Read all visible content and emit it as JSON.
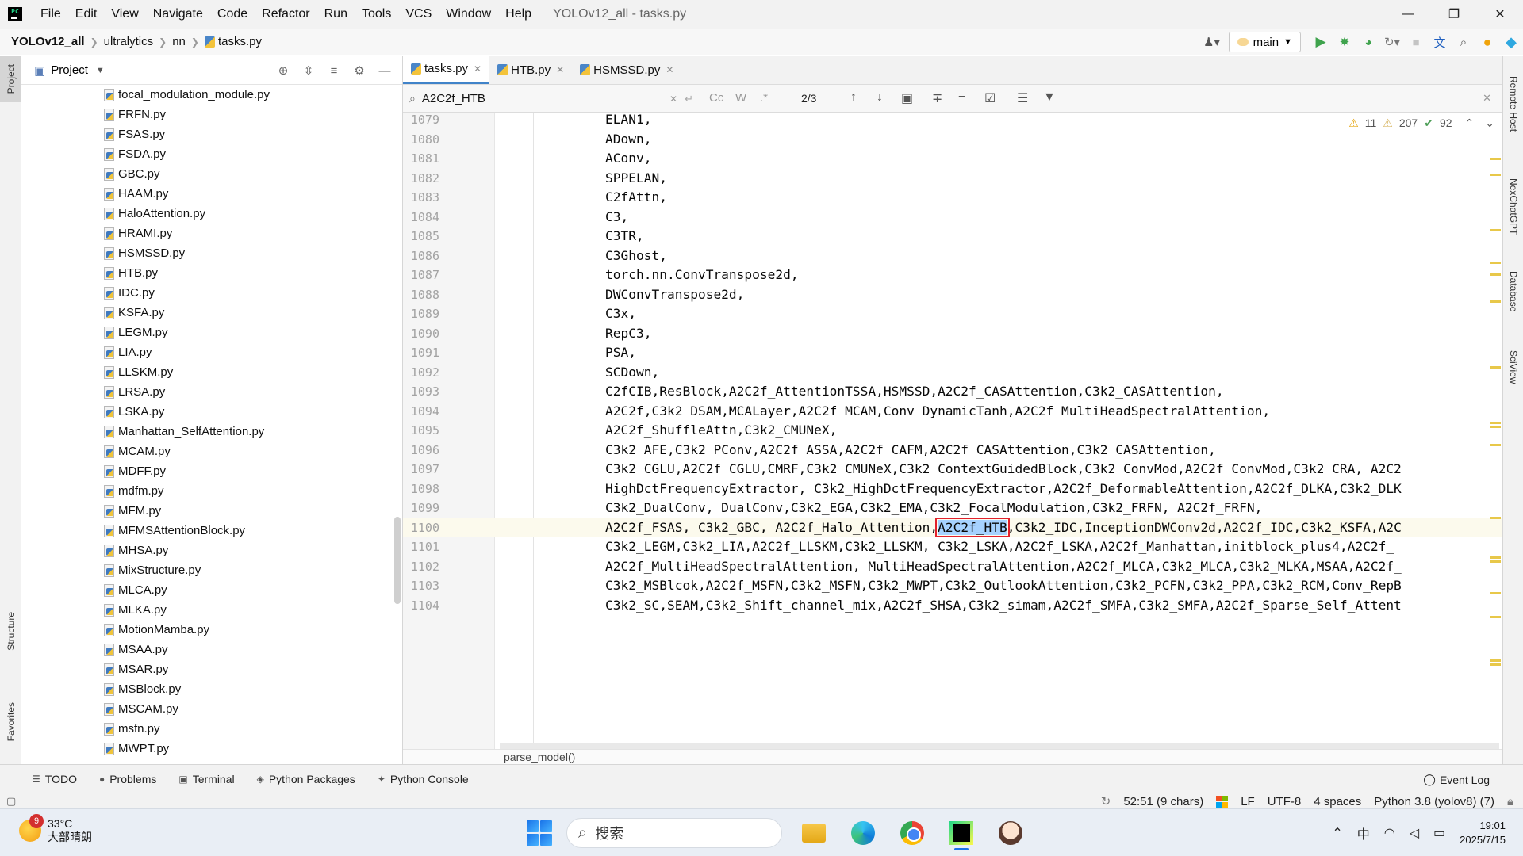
{
  "window": {
    "title": "YOLOv12_all - tasks.py",
    "menu": [
      "File",
      "Edit",
      "View",
      "Navigate",
      "Code",
      "Refactor",
      "Run",
      "Tools",
      "VCS",
      "Window",
      "Help"
    ]
  },
  "breadcrumb": [
    "YOLOv12_all",
    "ultralytics",
    "nn",
    "tasks.py"
  ],
  "navbar": {
    "branch": "main"
  },
  "project": {
    "title": "Project",
    "files": [
      "focal_modulation_module.py",
      "FRFN.py",
      "FSAS.py",
      "FSDA.py",
      "GBC.py",
      "HAAM.py",
      "HaloAttention.py",
      "HRAMI.py",
      "HSMSSD.py",
      "HTB.py",
      "IDC.py",
      "KSFA.py",
      "LEGM.py",
      "LIA.py",
      "LLSKM.py",
      "LRSA.py",
      "LSKA.py",
      "Manhattan_SelfAttention.py",
      "MCAM.py",
      "MDFF.py",
      "mdfm.py",
      "MFM.py",
      "MFMSAttentionBlock.py",
      "MHSA.py",
      "MixStructure.py",
      "MLCA.py",
      "MLKA.py",
      "MotionMamba.py",
      "MSAA.py",
      "MSAR.py",
      "MSBlock.py",
      "MSCAM.py",
      "msfn.py",
      "MWPT.py"
    ]
  },
  "tabs": [
    {
      "label": "tasks.py",
      "active": true
    },
    {
      "label": "HTB.py",
      "active": false
    },
    {
      "label": "HSMSSD.py",
      "active": false
    }
  ],
  "find": {
    "query": "A2C2f_HTB",
    "count": "2/3",
    "opt_case": "Cc",
    "opt_word": "W",
    "opt_regex": ".*"
  },
  "inspections": {
    "warnings": "11",
    "weak_warnings": "207",
    "ok": "92"
  },
  "code": {
    "current_line": 1100,
    "highlight": "A2C2f_HTB",
    "lines": [
      {
        "n": "1079",
        "text": "ELAN1,"
      },
      {
        "n": "1080",
        "text": "ADown,"
      },
      {
        "n": "1081",
        "text": "AConv,"
      },
      {
        "n": "1082",
        "text": "SPPELAN,"
      },
      {
        "n": "1083",
        "text": "C2fAttn,"
      },
      {
        "n": "1084",
        "text": "C3,"
      },
      {
        "n": "1085",
        "text": "C3TR,"
      },
      {
        "n": "1086",
        "text": "C3Ghost,"
      },
      {
        "n": "1087",
        "text": "torch.nn.ConvTranspose2d,"
      },
      {
        "n": "1088",
        "text": "DWConvTranspose2d,"
      },
      {
        "n": "1089",
        "text": "C3x,"
      },
      {
        "n": "1090",
        "text": "RepC3,"
      },
      {
        "n": "1091",
        "text": "PSA,"
      },
      {
        "n": "1092",
        "text": "SCDown,"
      },
      {
        "n": "1093",
        "text": "C2fCIB,ResBlock,A2C2f_AttentionTSSA,HSMSSD,A2C2f_CASAttention,C3k2_CASAttention,"
      },
      {
        "n": "1094",
        "text": "A2C2f,C3k2_DSAM,MCALayer,A2C2f_MCAM,Conv_DynamicTanh,A2C2f_MultiHeadSpectralAttention,"
      },
      {
        "n": "1095",
        "text": "A2C2f_ShuffleAttn,C3k2_CMUNeX,"
      },
      {
        "n": "1096",
        "text": "C3k2_AFE,C3k2_PConv,A2C2f_ASSA,A2C2f_CAFM,A2C2f_CASAttention,C3k2_CASAttention,"
      },
      {
        "n": "1097",
        "text": "C3k2_CGLU,A2C2f_CGLU,CMRF,C3k2_CMUNeX,C3k2_ContextGuidedBlock,C3k2_ConvMod,A2C2f_ConvMod,C3k2_CRA, A2C2"
      },
      {
        "n": "1098",
        "text": "HighDctFrequencyExtractor, C3k2_HighDctFrequencyExtractor,A2C2f_DeformableAttention,A2C2f_DLKA,C3k2_DLK"
      },
      {
        "n": "1099",
        "text": "C3k2_DualConv, DualConv,C3k2_EGA,C3k2_EMA,C3k2_FocalModulation,C3k2_FRFN, A2C2f_FRFN,"
      },
      {
        "n": "1100",
        "text_before": "A2C2f_FSAS, C3k2_GBC, A2C2f_Halo_Attention,",
        "text_match": "A2C2f_HTB",
        "text_after": ",C3k2_IDC,InceptionDWConv2d,A2C2f_IDC,C3k2_KSFA,A2C"
      },
      {
        "n": "1101",
        "text": "C3k2_LEGM,C3k2_LIA,A2C2f_LLSKM,C3k2_LLSKM, C3k2_LSKA,A2C2f_LSKA,A2C2f_Manhattan,initblock_plus4,A2C2f_"
      },
      {
        "n": "1102",
        "text": "A2C2f_MultiHeadSpectralAttention, MultiHeadSpectralAttention,A2C2f_MLCA,C3k2_MLCA,C3k2_MLKA,MSAA,A2C2f_"
      },
      {
        "n": "1103",
        "text": "C3k2_MSBlcok,A2C2f_MSFN,C3k2_MSFN,C3k2_MWPT,C3k2_OutlookAttention,C3k2_PCFN,C3k2_PPA,C3k2_RCM,Conv_RepB"
      },
      {
        "n": "1104",
        "text": "C3k2_SC,SEAM,C3k2_Shift_channel_mix,A2C2f_SHSA,C3k2_simam,A2C2f_SMFA,C3k2_SMFA,A2C2f_Sparse_Self_Attent"
      }
    ]
  },
  "editor_breadcrumb": "parse_model()",
  "left_strip": {
    "project": "Project",
    "structure": "Structure",
    "favorites": "Favorites"
  },
  "right_strip": [
    "Remote Host",
    "NexChatGPT",
    "Database",
    "SciView"
  ],
  "toolwindows": [
    "TODO",
    "Problems",
    "Terminal",
    "Python Packages",
    "Python Console"
  ],
  "event_log": "Event Log",
  "status": {
    "position": "52:51 (9 chars)",
    "line_sep": "LF",
    "encoding": "UTF-8",
    "indent": "4 spaces",
    "interpreter": "Python 3.8 (yolov8) (7)"
  },
  "taskbar": {
    "weather_temp": "33°C",
    "weather_desc": "大部晴朗",
    "weather_badge": "9",
    "search_placeholder": "搜索",
    "ime": "中",
    "time": "19:01",
    "date": "2025/7/15"
  },
  "colors": {
    "accent": "#4083c9",
    "highlight_bg": "#a6d2ff",
    "highlight_border": "#e2212b",
    "current_line": "#fcfaed",
    "warning": "#e6a817"
  }
}
